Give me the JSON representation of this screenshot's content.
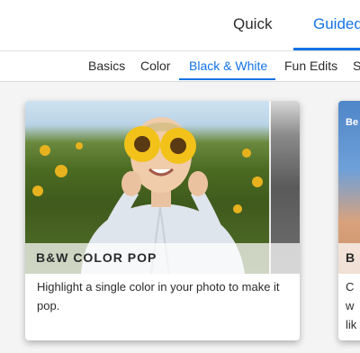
{
  "modes": {
    "quick": "Quick",
    "guided": "Guided",
    "active": "Guided"
  },
  "categories": {
    "items": [
      "Basics",
      "Color",
      "Black & White",
      "Fun Edits",
      "S"
    ],
    "active": "Black & White"
  },
  "cards": [
    {
      "title": "B&W COLOR POP",
      "description": "Highlight a single color in your photo to make it pop."
    },
    {
      "badge": "Be",
      "title": "B",
      "description": "C\nw\nlik"
    }
  ],
  "colors": {
    "accent": "#1473e6",
    "text": "#2c2c2c",
    "background": "#f4f4f4"
  }
}
